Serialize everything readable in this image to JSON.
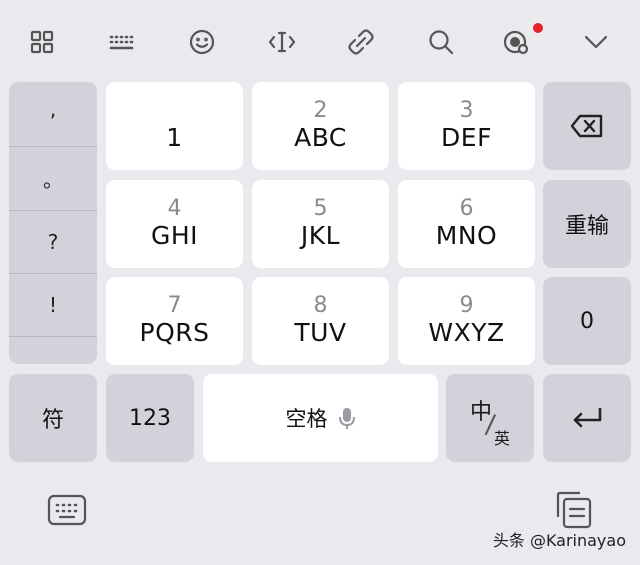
{
  "toolbar": {
    "icons": [
      "apps-grid-icon",
      "keyboard-layout-icon",
      "emoji-icon",
      "cursor-edit-icon",
      "link-clip-icon",
      "search-icon",
      "theme-badge-icon",
      "chevron-down-icon"
    ]
  },
  "punctuation": [
    ",",
    "。",
    "?",
    "!"
  ],
  "keys": {
    "k1": {
      "num": "",
      "letters": "1"
    },
    "k2": {
      "num": "2",
      "letters": "ABC"
    },
    "k3": {
      "num": "3",
      "letters": "DEF"
    },
    "k4": {
      "num": "4",
      "letters": "GHI"
    },
    "k5": {
      "num": "5",
      "letters": "JKL"
    },
    "k6": {
      "num": "6",
      "letters": "MNO"
    },
    "k7": {
      "num": "7",
      "letters": "PQRS"
    },
    "k8": {
      "num": "8",
      "letters": "TUV"
    },
    "k9": {
      "num": "9",
      "letters": "WXYZ"
    }
  },
  "side": {
    "retype": "重输",
    "zero": "0"
  },
  "bottom": {
    "symbols": "符",
    "numbers": "123",
    "space": "空格",
    "lang_main": "中",
    "lang_sub": "英"
  },
  "watermark": "头条 @Karinayao",
  "colors": {
    "background": "#e9e9ee",
    "key_white": "#ffffff",
    "key_gray": "#d2d3da",
    "notify_dot": "#e8232d"
  }
}
